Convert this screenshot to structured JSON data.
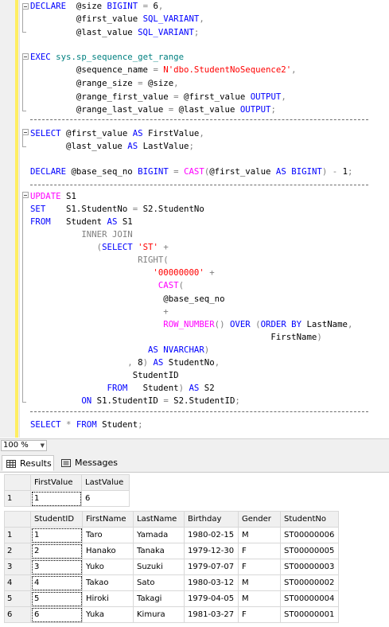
{
  "editor": {
    "lines": [
      [
        [
          "k",
          "DECLARE"
        ],
        [
          "",
          "  @size "
        ],
        [
          "k",
          "BIGINT"
        ],
        [
          "g",
          " = "
        ],
        [
          "",
          "6"
        ],
        [
          "g",
          ","
        ]
      ],
      [
        [
          "",
          "         @first_value "
        ],
        [
          "k",
          "SQL_VARIANT"
        ],
        [
          "g",
          ","
        ]
      ],
      [
        [
          "",
          "         @last_value "
        ],
        [
          "k",
          "SQL_VARIANT"
        ],
        [
          "g",
          ";"
        ]
      ],
      [
        [
          "",
          ""
        ]
      ],
      [
        [
          "k",
          "EXEC"
        ],
        [
          "",
          ""
        ],
        [
          "p",
          " sys.sp_sequence_get_range"
        ]
      ],
      [
        [
          "",
          "         @sequence_name "
        ],
        [
          "g",
          "="
        ],
        [
          "s",
          " N'dbo.StudentNoSequence2'"
        ],
        [
          "g",
          ","
        ]
      ],
      [
        [
          "",
          "         @range_size "
        ],
        [
          "g",
          "="
        ],
        [
          "",
          " @size"
        ],
        [
          "g",
          ","
        ]
      ],
      [
        [
          "",
          "         @range_first_value "
        ],
        [
          "g",
          "="
        ],
        [
          "",
          " @first_value "
        ],
        [
          "k",
          "OUTPUT"
        ],
        [
          "g",
          ","
        ]
      ],
      [
        [
          "",
          "         @range_last_value "
        ],
        [
          "g",
          "="
        ],
        [
          "",
          " @last_value "
        ],
        [
          "k",
          "OUTPUT"
        ],
        [
          "g",
          ";"
        ]
      ],
      [
        [
          "",
          ""
        ]
      ],
      [
        [
          "k",
          "SELECT"
        ],
        [
          "",
          " @first_value "
        ],
        [
          "k",
          "AS"
        ],
        [
          "",
          " FirstValue"
        ],
        [
          "g",
          ","
        ]
      ],
      [
        [
          "",
          "       @last_value "
        ],
        [
          "k",
          "AS"
        ],
        [
          "",
          " LastValue"
        ],
        [
          "g",
          ";"
        ]
      ],
      [
        [
          "",
          ""
        ]
      ],
      [
        [
          "k",
          "DECLARE"
        ],
        [
          "",
          " @base_seq_no "
        ],
        [
          "k",
          "BIGINT"
        ],
        [
          "g",
          " = "
        ],
        [
          "f",
          "CAST"
        ],
        [
          "g",
          "("
        ],
        [
          "",
          "@first_value "
        ],
        [
          "k",
          "AS"
        ],
        [
          "k",
          " BIGINT"
        ],
        [
          "g",
          ")"
        ],
        [
          "g",
          " - "
        ],
        [
          "",
          "1"
        ],
        [
          "g",
          ";"
        ]
      ],
      [
        [
          "",
          ""
        ]
      ],
      [
        [
          "f",
          "UPDATE"
        ],
        [
          "",
          " S1"
        ]
      ],
      [
        [
          "k",
          "SET"
        ],
        [
          "",
          "    S1.StudentNo "
        ],
        [
          "g",
          "="
        ],
        [
          "",
          " S2.StudentNo"
        ]
      ],
      [
        [
          "k",
          "FROM"
        ],
        [
          "",
          "   Student "
        ],
        [
          "k",
          "AS"
        ],
        [
          "",
          " S1"
        ]
      ],
      [
        [
          "g",
          "          INNER JOIN"
        ]
      ],
      [
        [
          "g",
          "             ("
        ],
        [
          "k",
          "SELECT"
        ],
        [
          "s",
          " 'ST'"
        ],
        [
          "g",
          " +"
        ]
      ],
      [
        [
          "g",
          "                     RIGHT("
        ]
      ],
      [
        [
          "s",
          "                        '00000000'"
        ],
        [
          "g",
          " +"
        ]
      ],
      [
        [
          "f",
          "                         CAST"
        ],
        [
          "g",
          "("
        ]
      ],
      [
        [
          "",
          "                          @base_seq_no"
        ]
      ],
      [
        [
          "g",
          "                          +"
        ]
      ],
      [
        [
          "f",
          "                          ROW_NUMBER"
        ],
        [
          "g",
          "()"
        ],
        [
          "k",
          " OVER"
        ],
        [
          "g",
          " ("
        ],
        [
          "k",
          "ORDER BY"
        ],
        [
          "",
          " LastName"
        ],
        [
          "g",
          ","
        ]
      ],
      [
        [
          "",
          "                                               FirstName"
        ],
        [
          "g",
          ")"
        ]
      ],
      [
        [
          "k",
          "                       AS"
        ],
        [
          "k",
          " NVARCHAR"
        ],
        [
          "g",
          ")"
        ]
      ],
      [
        [
          "g",
          "                   ,"
        ],
        [
          "",
          " 8"
        ],
        [
          "g",
          ")"
        ],
        [
          "k",
          " AS"
        ],
        [
          "",
          " StudentNo"
        ],
        [
          "g",
          ","
        ]
      ],
      [
        [
          "",
          "                    StudentID"
        ]
      ],
      [
        [
          "k",
          "               FROM"
        ],
        [
          "",
          "   Student"
        ],
        [
          "g",
          ")"
        ],
        [
          "k",
          " AS"
        ],
        [
          "",
          " S2"
        ]
      ],
      [
        [
          "k",
          "          ON"
        ],
        [
          "",
          " S1.StudentID "
        ],
        [
          "g",
          "="
        ],
        [
          "",
          " S2.StudentID"
        ],
        [
          "g",
          ";"
        ]
      ],
      [
        [
          "",
          ""
        ]
      ],
      [
        [
          "k",
          "SELECT"
        ],
        [
          "g",
          " *"
        ],
        [
          "k",
          " FROM"
        ],
        [
          "",
          " Student"
        ],
        [
          "g",
          ";"
        ]
      ]
    ]
  },
  "zoom": {
    "value": "100 %"
  },
  "tabs": {
    "results": "Results",
    "messages": "Messages"
  },
  "result1": {
    "columns": [
      "FirstValue",
      "LastValue"
    ],
    "rows": [
      {
        "n": "1",
        "cells": [
          "1",
          "6"
        ]
      }
    ]
  },
  "result2": {
    "columns": [
      "StudentID",
      "FirstName",
      "LastName",
      "Birthday",
      "Gender",
      "StudentNo"
    ],
    "rows": [
      {
        "n": "1",
        "cells": [
          "1",
          "Taro",
          "Yamada",
          "1980-02-15",
          "M",
          "ST00000006"
        ]
      },
      {
        "n": "2",
        "cells": [
          "2",
          "Hanako",
          "Tanaka",
          "1979-12-30",
          "F",
          "ST00000005"
        ]
      },
      {
        "n": "3",
        "cells": [
          "3",
          "Yuko",
          "Suzuki",
          "1979-07-07",
          "F",
          "ST00000003"
        ]
      },
      {
        "n": "4",
        "cells": [
          "4",
          "Takao",
          "Sato",
          "1980-03-12",
          "M",
          "ST00000002"
        ]
      },
      {
        "n": "5",
        "cells": [
          "5",
          "Hiroki",
          "Takagi",
          "1979-04-05",
          "M",
          "ST00000004"
        ]
      },
      {
        "n": "6",
        "cells": [
          "6",
          "Yuka",
          "Kimura",
          "1981-03-27",
          "F",
          "ST00000001"
        ]
      }
    ]
  }
}
